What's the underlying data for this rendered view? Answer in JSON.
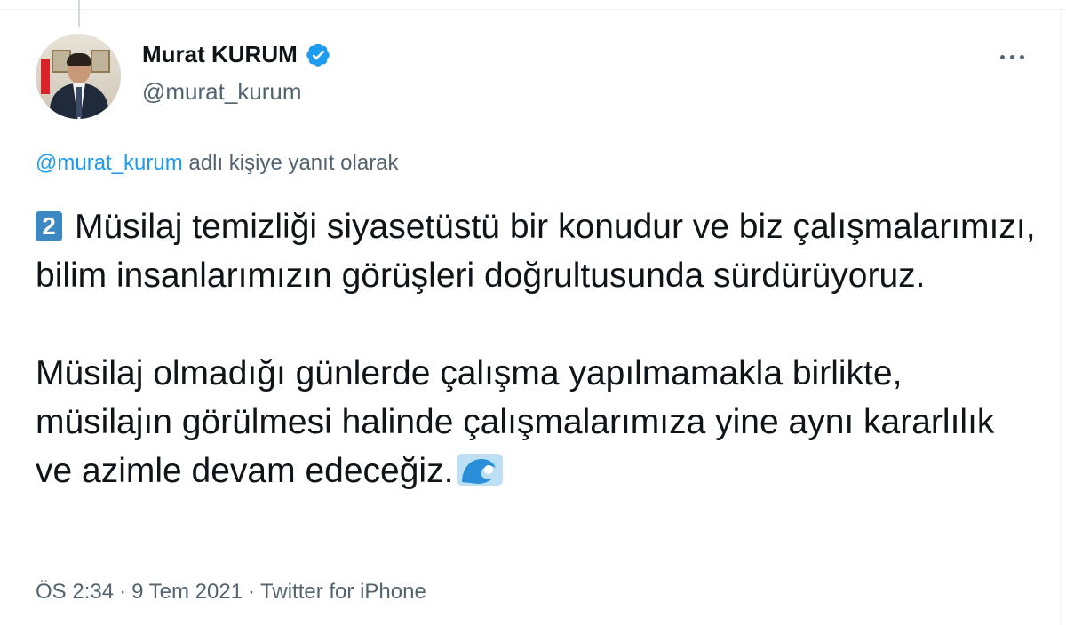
{
  "tweet": {
    "display_name": "Murat KURUM",
    "handle": "@murat_kurum",
    "reply_to_handle": "@murat_kurum",
    "reply_suffix": " adlı kişiye yanıt olarak",
    "number_emoji": "2",
    "paragraph1": "Müsilaj temizliği siyasetüstü bir konudur ve biz çalışmalarımızı, bilim insanlarımızın görüşleri doğrultusunda sürdürüyoruz.",
    "paragraph2": "Müsilaj olmadığı günlerde çalışma yapılmamakla birlikte, müsilajın görülmesi halinde çalışmalarımıza yine aynı kararlılık ve azimle devam edeceğiz.",
    "time": "ÖS 2:34",
    "date": "9 Tem 2021",
    "source": "Twitter for iPhone",
    "separator": "·"
  },
  "icons": {
    "verified": "verified-badge-icon",
    "more": "more-options-icon",
    "wave": "water-wave-icon"
  },
  "colors": {
    "accent": "#1d9bf0",
    "secondary_text": "#536471",
    "primary_text": "#0f1419",
    "number_badge": "#3b88c3"
  }
}
